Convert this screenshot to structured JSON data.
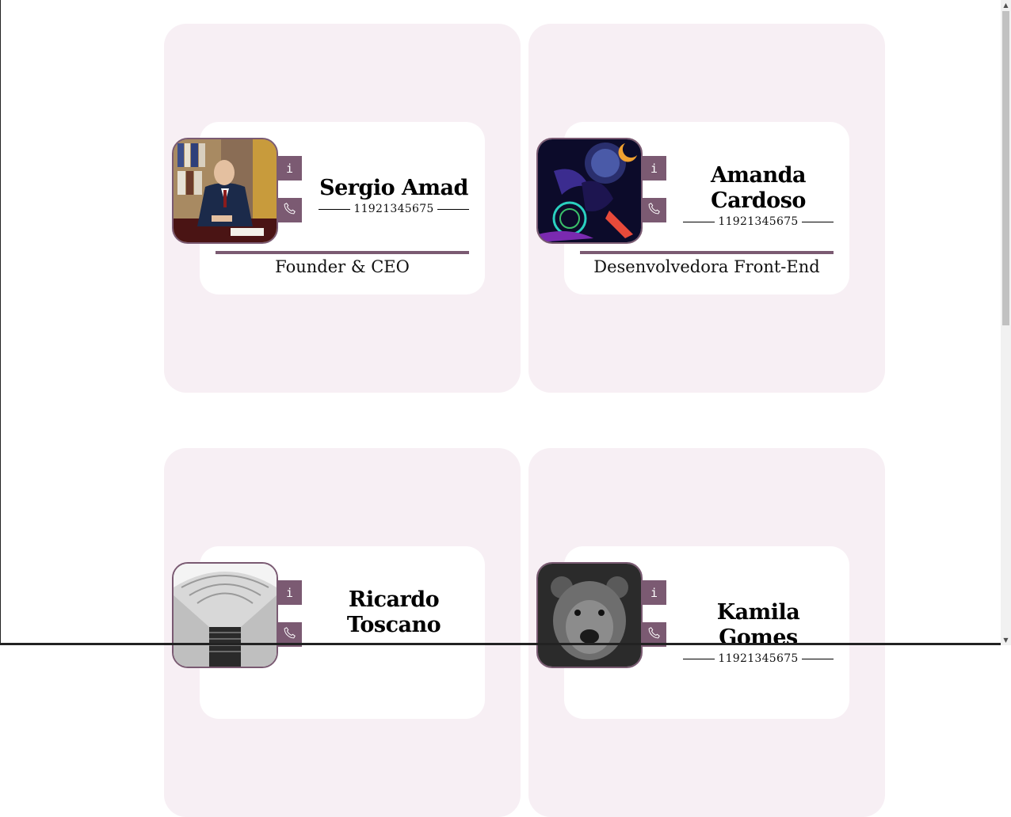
{
  "buttons": {
    "info_glyph": "i",
    "info_icon": "info-icon",
    "phone_icon": "phone-icon"
  },
  "colors": {
    "accent": "#7b5a72",
    "card_bg": "#f7eff4",
    "inner_bg": "#ffffff"
  },
  "profiles": [
    {
      "name_lines": [
        "Sergio Amad"
      ],
      "phone": "11921345675",
      "role": "Founder & CEO",
      "photo": "man-at-desk-painting"
    },
    {
      "name_lines": [
        "Amanda",
        "Cardoso"
      ],
      "phone": "11921345675",
      "role": "Desenvolvedora Front-End",
      "photo": "space-fantasy-artwork"
    },
    {
      "name_lines": [
        "Ricardo",
        "Toscano"
      ],
      "phone": "",
      "role": "",
      "photo": "architecture-staircase"
    },
    {
      "name_lines": [
        "Kamila Gomes"
      ],
      "phone": "11921345675",
      "role": "",
      "photo": "bear-portrait"
    }
  ]
}
